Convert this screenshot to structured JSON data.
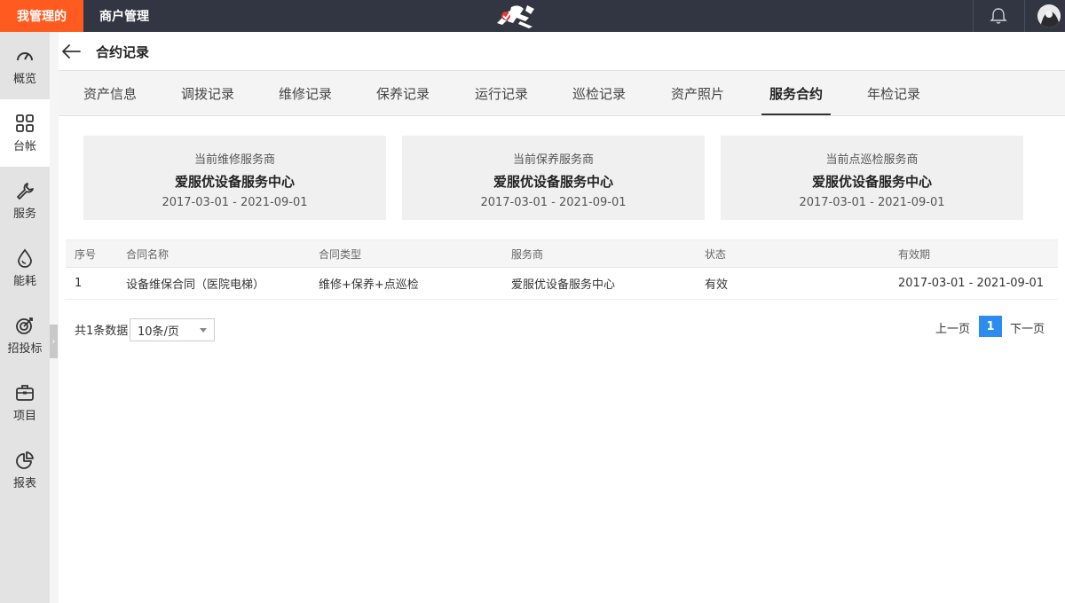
{
  "topbar": {
    "brand_tab": "我管理的",
    "merchant_tab": "商户管理"
  },
  "sidebar": {
    "items": [
      {
        "label": "概览",
        "icon": "speedometer-icon"
      },
      {
        "label": "台帐",
        "icon": "grid-icon"
      },
      {
        "label": "服务",
        "icon": "wrench-icon"
      },
      {
        "label": "能耗",
        "icon": "drop-icon"
      },
      {
        "label": "招投标",
        "icon": "target-icon"
      },
      {
        "label": "项目",
        "icon": "briefcase-icon"
      },
      {
        "label": "报表",
        "icon": "pie-chart-icon"
      }
    ],
    "active_index": 1
  },
  "header": {
    "title": "合约记录"
  },
  "tabs": [
    {
      "label": "资产信息"
    },
    {
      "label": "调拨记录"
    },
    {
      "label": "维修记录"
    },
    {
      "label": "保养记录"
    },
    {
      "label": "运行记录"
    },
    {
      "label": "巡检记录"
    },
    {
      "label": "资产照片"
    },
    {
      "label": "服务合约",
      "active": true
    },
    {
      "label": "年检记录"
    }
  ],
  "cards": [
    {
      "label": "当前维修服务商",
      "name": "爱服优设备服务中心",
      "period": "2017-03-01 - 2021-09-01"
    },
    {
      "label": "当前保养服务商",
      "name": "爱服优设备服务中心",
      "period": "2017-03-01 - 2021-09-01"
    },
    {
      "label": "当前点巡检服务商",
      "name": "爱服优设备服务中心",
      "period": "2017-03-01 - 2021-09-01"
    }
  ],
  "table": {
    "columns": [
      "序号",
      "合同名称",
      "合同类型",
      "服务商",
      "状态",
      "有效期"
    ],
    "rows": [
      [
        "1",
        "设备维保合同（医院电梯）",
        "维修+保养+点巡检",
        "爱服优设备服务中心",
        "有效",
        "2017-03-01 - 2021-09-01"
      ]
    ]
  },
  "pagination": {
    "total": "共1条数据",
    "page_size": "10条/页",
    "prev": "上一页",
    "current": "1",
    "next": "下一页"
  },
  "colors": {
    "brand": "#ff5a1f",
    "topbar": "#323642",
    "accent": "#2d8cf0"
  }
}
